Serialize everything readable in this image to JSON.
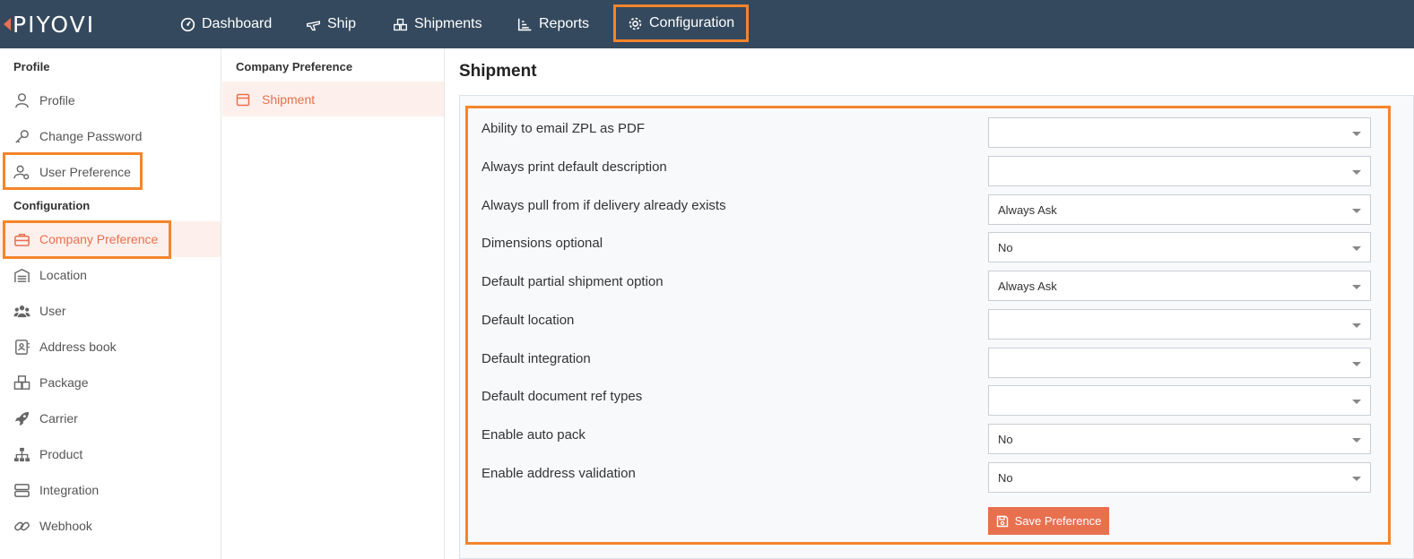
{
  "brand": {
    "logo_text": "PIYOVI",
    "accent": "#e8704f",
    "nav_bg": "#34495e",
    "highlight": "#f5852b"
  },
  "topnav": {
    "items": [
      {
        "label": "Dashboard",
        "icon": "dashboard-gauge-icon"
      },
      {
        "label": "Ship",
        "icon": "plane-icon"
      },
      {
        "label": "Shipments",
        "icon": "boxes-icon"
      },
      {
        "label": "Reports",
        "icon": "bar-chart-icon"
      },
      {
        "label": "Configuration",
        "icon": "gear-icon",
        "active": true
      }
    ]
  },
  "sidebar": {
    "profile_heading": "Profile",
    "profile_items": [
      {
        "label": "Profile",
        "icon": "user-icon"
      },
      {
        "label": "Change Password",
        "icon": "key-icon"
      },
      {
        "label": "User Preference",
        "icon": "user-gear-icon"
      }
    ],
    "config_heading": "Configuration",
    "config_items": [
      {
        "label": "Company Preference",
        "icon": "briefcase-icon",
        "active": true
      },
      {
        "label": "Location",
        "icon": "warehouse-icon"
      },
      {
        "label": "User",
        "icon": "users-icon"
      },
      {
        "label": "Address book",
        "icon": "address-book-icon"
      },
      {
        "label": "Package",
        "icon": "package-icon"
      },
      {
        "label": "Carrier",
        "icon": "rocket-icon"
      },
      {
        "label": "Product",
        "icon": "sitemap-icon"
      },
      {
        "label": "Integration",
        "icon": "server-icon"
      },
      {
        "label": "Webhook",
        "icon": "link-icon"
      }
    ]
  },
  "company_preference": {
    "heading": "Company Preference",
    "items": [
      {
        "label": "Shipment",
        "icon": "calendar-box-icon",
        "active": true
      }
    ]
  },
  "main": {
    "title": "Shipment",
    "fields": [
      {
        "label": "Ability to email ZPL as PDF",
        "value": ""
      },
      {
        "label": "Always print default description",
        "value": ""
      },
      {
        "label": "Always pull from if delivery already exists",
        "value": "Always Ask"
      },
      {
        "label": "Dimensions optional",
        "value": "No"
      },
      {
        "label": "Default partial shipment option",
        "value": "Always Ask"
      },
      {
        "label": "Default location",
        "value": ""
      },
      {
        "label": "Default integration",
        "value": ""
      },
      {
        "label": "Default document ref types",
        "value": ""
      },
      {
        "label": "Enable auto pack",
        "value": "No"
      },
      {
        "label": "Enable address validation",
        "value": "No"
      }
    ],
    "save_label": "Save Preference"
  }
}
